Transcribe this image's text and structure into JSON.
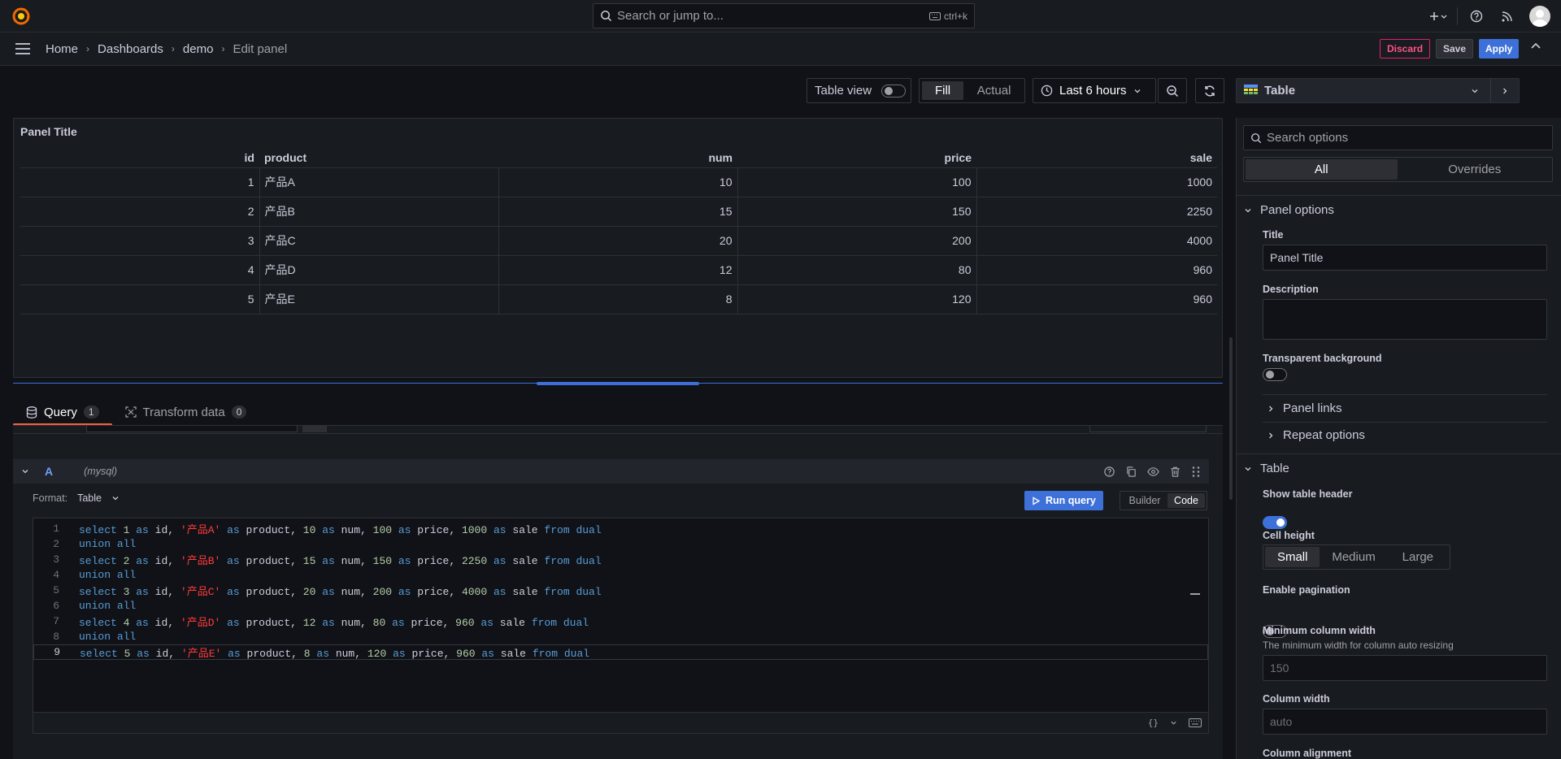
{
  "topbar": {
    "search_placeholder": "Search or jump to...",
    "search_shortcut": "ctrl+k"
  },
  "breadcrumb": [
    {
      "label": "Home"
    },
    {
      "label": "Dashboards"
    },
    {
      "label": "demo"
    },
    {
      "label": "Edit panel"
    }
  ],
  "actions": {
    "discard": "Discard",
    "save": "Save",
    "apply": "Apply"
  },
  "toolbar": {
    "table_view": "Table view",
    "fill": "Fill",
    "actual": "Actual",
    "time_range": "Last 6 hours",
    "visualization": "Table"
  },
  "panel": {
    "title": "Panel Title",
    "columns": [
      "id",
      "product",
      "num",
      "price",
      "sale"
    ],
    "rows": [
      [
        "1",
        "产品A",
        "10",
        "100",
        "1000"
      ],
      [
        "2",
        "产品B",
        "15",
        "150",
        "2250"
      ],
      [
        "3",
        "产品C",
        "20",
        "200",
        "4000"
      ],
      [
        "4",
        "产品D",
        "12",
        "80",
        "960"
      ],
      [
        "5",
        "产品E",
        "8",
        "120",
        "960"
      ]
    ]
  },
  "tabs": [
    {
      "label": "Query",
      "count": "1"
    },
    {
      "label": "Transform data",
      "count": "0"
    }
  ],
  "query": {
    "ref": "A",
    "datasource": "(mysql)",
    "format_label": "Format:",
    "format_value": "Table",
    "run_query": "Run query",
    "builder": "Builder",
    "code": "Code"
  },
  "code_lines": [
    "select 1 as id, '产品A' as product, 10 as num, 100 as price, 1000 as sale from dual",
    "union all",
    "select 2 as id, '产品B' as product, 15 as num, 150 as price, 2250 as sale from dual",
    "union all",
    "select 3 as id, '产品C' as product, 20 as num, 200 as price, 4000 as sale from dual",
    "union all",
    "select 4 as id, '产品D' as product, 12 as num, 80 as price, 960 as sale from dual",
    "union all",
    "select 5 as id, '产品E' as product, 8 as num, 120 as price, 960 as sale from dual"
  ],
  "options": {
    "search_placeholder": "Search options",
    "tab_all": "All",
    "tab_overrides": "Overrides",
    "panel_options": "Panel options",
    "title_label": "Title",
    "title_value": "Panel Title",
    "description_label": "Description",
    "transparent_label": "Transparent background",
    "panel_links": "Panel links",
    "repeat_options": "Repeat options",
    "table_section": "Table",
    "show_header_label": "Show table header",
    "cell_height_label": "Cell height",
    "cell_heights": [
      "Small",
      "Medium",
      "Large"
    ],
    "pagination_label": "Enable pagination",
    "min_col_width_label": "Minimum column width",
    "min_col_width_desc": "The minimum width for column auto resizing",
    "min_col_width_placeholder": "150",
    "col_width_label": "Column width",
    "col_width_placeholder": "auto",
    "col_align_label": "Column alignment"
  },
  "colors": {
    "accent": "#3d71d9",
    "tab_active": "#f55f3e",
    "discard": "#ff5286"
  }
}
